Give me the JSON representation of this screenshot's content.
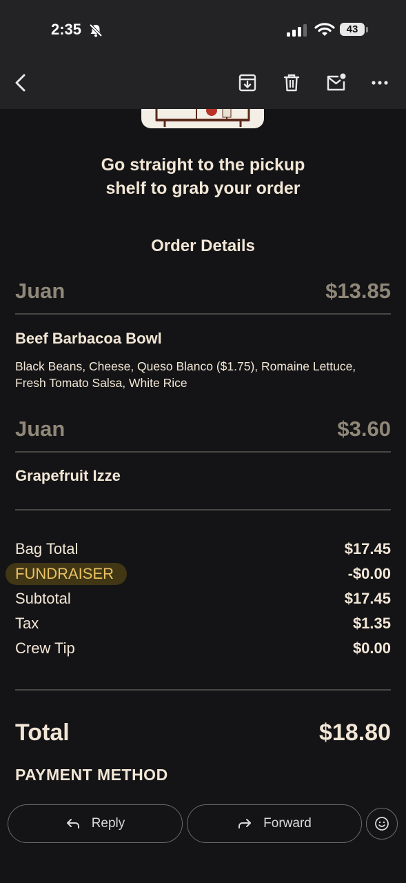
{
  "status": {
    "time": "2:35",
    "battery": "43"
  },
  "headline": {
    "line1": "Go straight to the pickup",
    "line2": "shelf to grab your order"
  },
  "order_title": "Order Details",
  "items": [
    {
      "name": "Juan",
      "price": "$13.85",
      "title": "Beef Barbacoa Bowl",
      "mods_line1": "Black Beans, Cheese, Queso Blanco ($1.75), Romaine Lettuce,",
      "mods_line2": "Fresh Tomato Salsa, White Rice"
    },
    {
      "name": "Juan",
      "price": "$3.60",
      "title": "Grapefruit Izze"
    }
  ],
  "summary": [
    {
      "label": "Bag Total",
      "value": "$17.45"
    },
    {
      "label": "FUNDRAISER",
      "value": "-$0.00"
    },
    {
      "label": "Subtotal",
      "value": "$17.45"
    },
    {
      "label": "Tax",
      "value": "$1.35"
    },
    {
      "label": "Crew Tip",
      "value": "$0.00"
    }
  ],
  "total": {
    "label": "Total",
    "value": "$18.80"
  },
  "payment_method": "PAYMENT METHOD",
  "actions": {
    "reply": "Reply",
    "forward": "Forward"
  },
  "colors": {
    "background": "#141416",
    "toolbar": "#232325",
    "text": "#f2e6d6",
    "muted": "#8f8778",
    "fundraiser": "#e9c163"
  }
}
